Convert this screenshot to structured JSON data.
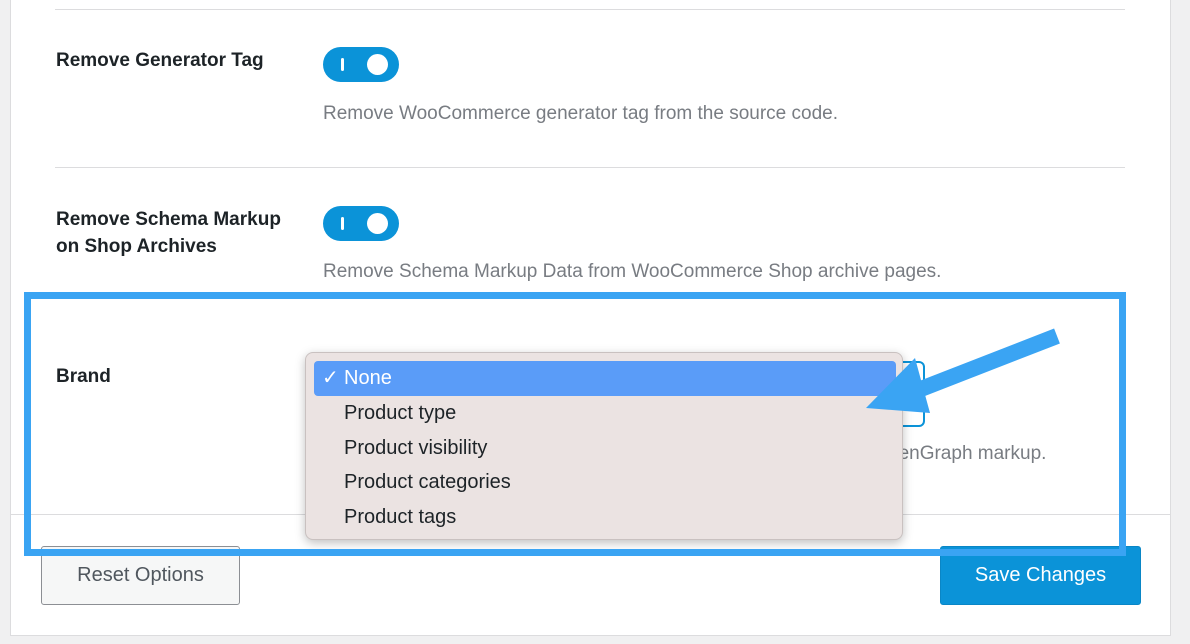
{
  "settings": {
    "generator": {
      "label": "Remove Generator Tag",
      "description": "Remove WooCommerce generator tag from the source code.",
      "enabled": true
    },
    "schema": {
      "label": "Remove Schema Markup on Shop Archives",
      "description": "Remove Schema Markup Data from WooCommerce Shop archive pages.",
      "enabled": true
    },
    "brand": {
      "label": "Brand",
      "description_partial": "penGraph markup."
    }
  },
  "dropdown": {
    "check_glyph": "✓",
    "options": [
      "None",
      "Product type",
      "Product visibility",
      "Product categories",
      "Product tags"
    ],
    "selected_index": 0
  },
  "footer": {
    "reset_label": "Reset Options",
    "save_label": "Save Changes"
  },
  "colors": {
    "accent": "#0b93d8",
    "annotation": "#3aa4f3",
    "selected_option": "#5a9cf8"
  },
  "icons": {
    "toggle": "toggle-switch-icon",
    "check": "checkmark-icon",
    "annotation_arrow": "arrow-icon"
  }
}
